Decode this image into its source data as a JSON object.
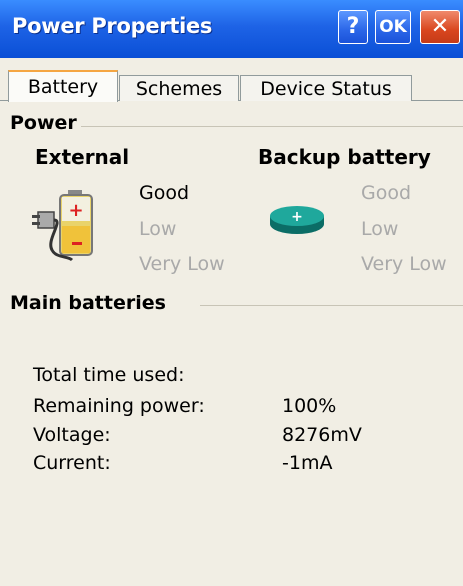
{
  "window": {
    "title": "Power Properties",
    "help_label": "?",
    "ok_label": "OK",
    "close_label": "✕"
  },
  "tabs": [
    {
      "label": "Battery",
      "selected": true
    },
    {
      "label": "Schemes",
      "selected": false
    },
    {
      "label": "Device Status",
      "selected": false
    }
  ],
  "power": {
    "group_title": "Power",
    "external": {
      "heading": "External",
      "icon": "battery-plug-icon",
      "states": [
        "Good",
        "Low",
        "Very Low"
      ],
      "active_state": "Good"
    },
    "backup": {
      "heading": "Backup battery",
      "icon": "coin-battery-icon",
      "states": [
        "Good",
        "Low",
        "Very Low"
      ],
      "active_state": "none"
    }
  },
  "main_batteries": {
    "group_title": "Main batteries",
    "rows": [
      {
        "label": "Total time used:",
        "value": ""
      },
      {
        "label": "Remaining power:",
        "value": "100%"
      },
      {
        "label": "Voltage:",
        "value": "8276mV"
      },
      {
        "label": "Current:",
        "value": "-1mA"
      }
    ]
  },
  "colors": {
    "titlebar": "#1e63e6",
    "close_button": "#d9461f",
    "background": "#f1eee4",
    "dim_text": "#a9a9a9",
    "tab_highlight": "#f5a642"
  }
}
